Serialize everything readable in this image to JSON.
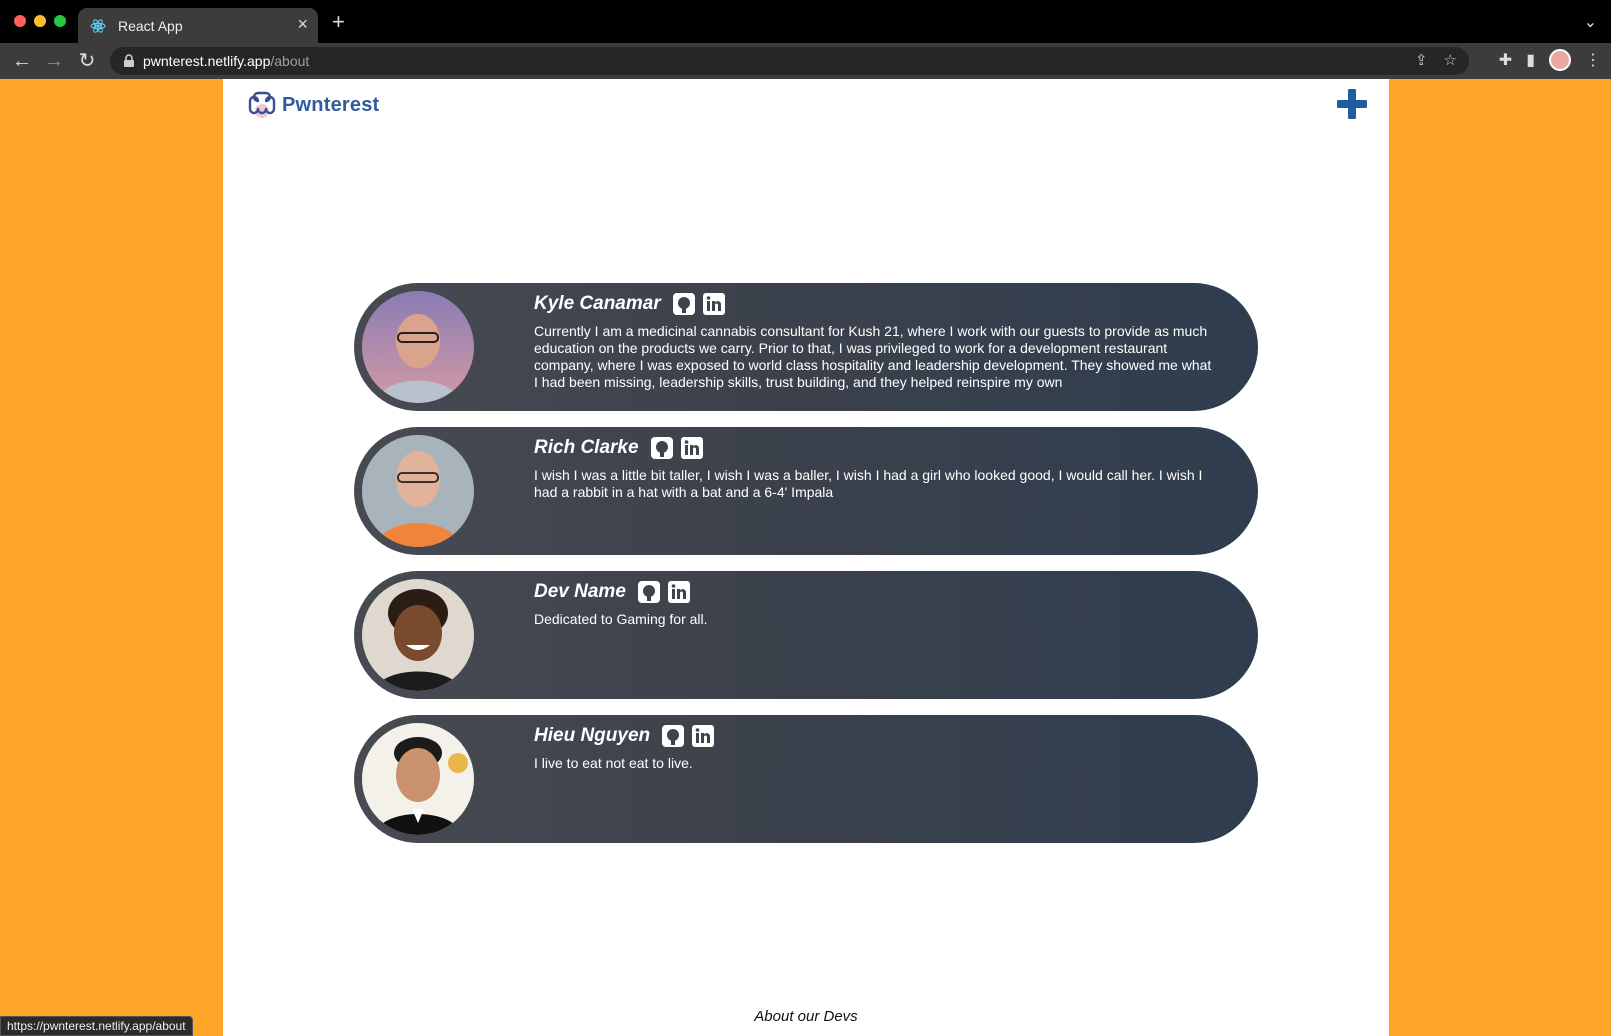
{
  "browser": {
    "tab_title": "React App",
    "url_host": "pwnterest.netlify.app",
    "url_path": "/about",
    "status_url": "https://pwnterest.netlify.app/about"
  },
  "header": {
    "logo_text": "Pwnterest",
    "add_icon": "plus-icon",
    "accent_color": "#1f5b9e"
  },
  "devs": [
    {
      "name": "Kyle Canamar",
      "bio": "Currently I am a medicinal cannabis consultant for Kush 21, where I work with our guests to provide as much education on the products we carry. Prior to that, I was privileged to work for a development restaurant company, where I was exposed to world class hospitality and leadership development. They showed me what I had been missing, leadership skills, trust building, and they helped reinspire my own"
    },
    {
      "name": "Rich Clarke",
      "bio": "I wish I was a little bit taller, I wish I was a baller, I wish I had a girl who looked good, I would call her. I wish I had a rabbit in a hat with a bat and a 6-4' Impala"
    },
    {
      "name": "Dev Name",
      "bio": "Dedicated to Gaming for all."
    },
    {
      "name": "Hieu Nguyen",
      "bio": "I live to eat not eat to live."
    }
  ],
  "footer": {
    "text": "About our Devs"
  },
  "colors": {
    "background": "#fda627",
    "card_start": "#474a51",
    "card_end": "#2f3d4f"
  }
}
